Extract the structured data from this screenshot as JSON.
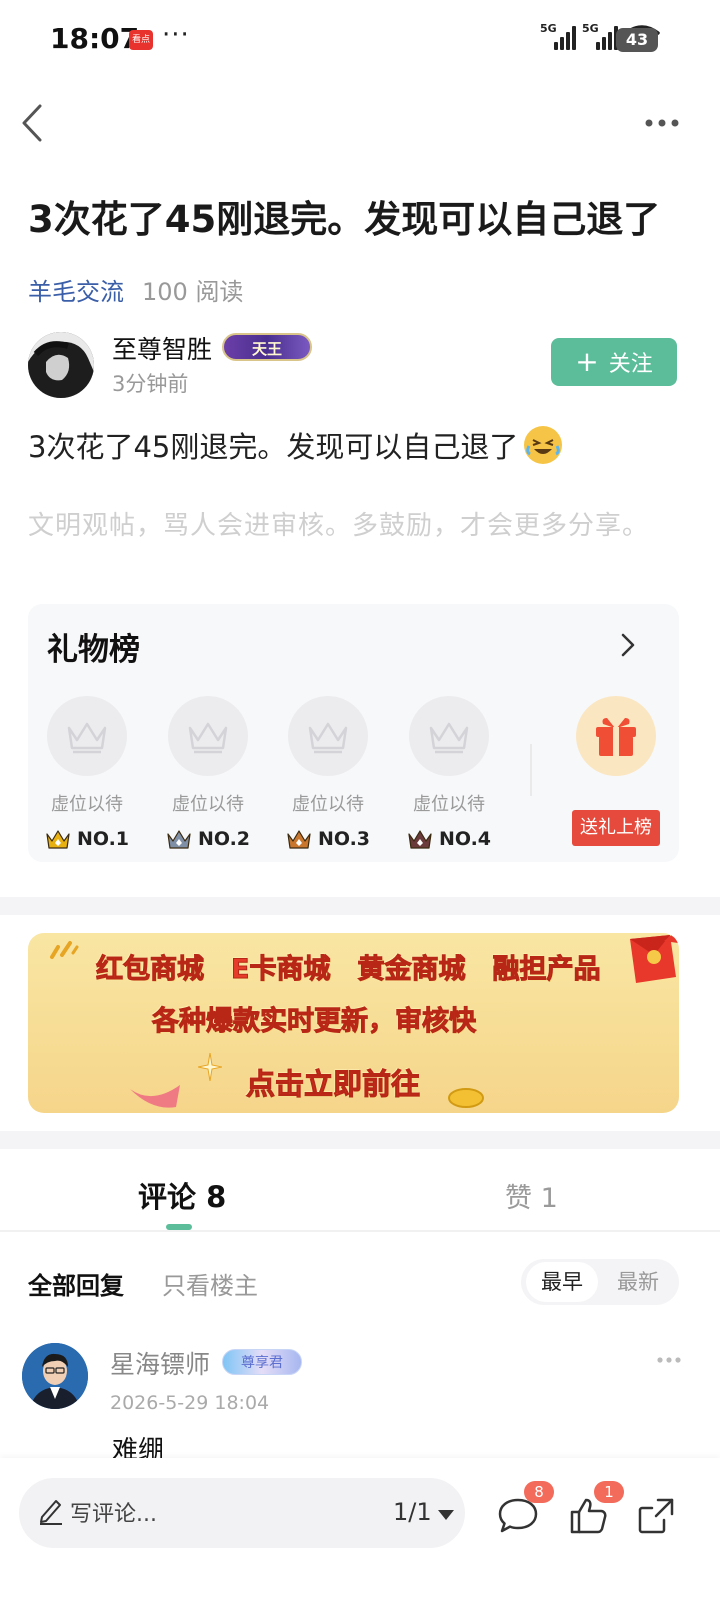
{
  "status_bar": {
    "time": "18:07",
    "app_badge": "看点",
    "more": "···",
    "network_1": "5G",
    "network_2": "5G",
    "battery": "43"
  },
  "post": {
    "title": "3次花了45刚退完。发现可以自己退了",
    "tag": "羊毛交流",
    "reads": "100 阅读",
    "author_name": "至尊智胜",
    "author_badge": "天王",
    "post_time": "3分钟前",
    "follow_label": "关注",
    "content": "3次花了45刚退完。发现可以自己退了",
    "hint": "文明观帖，骂人会进审核。多鼓励，才会更多分享。"
  },
  "gift_board": {
    "title": "礼物榜",
    "slots": [
      {
        "label": "虚位以待",
        "rank": "NO.1",
        "color": "#e8b10f"
      },
      {
        "label": "虚位以待",
        "rank": "NO.2",
        "color": "#7f8fa6"
      },
      {
        "label": "虚位以待",
        "rank": "NO.3",
        "color": "#c9772e"
      },
      {
        "label": "虚位以待",
        "rank": "NO.4",
        "color": "#6b3a3a"
      }
    ],
    "send_label": "送礼上榜"
  },
  "banner": {
    "line1": "红包商城　E卡商城　黄金商城　融担产品",
    "line2": "各种爆款实时更新，审核快",
    "line3": "点击立即前往"
  },
  "tabs": {
    "comments": "评论 8",
    "likes": "赞 1"
  },
  "filters": {
    "all": "全部回复",
    "op_only": "只看楼主",
    "sort_earliest": "最早",
    "sort_latest": "最新"
  },
  "comments": [
    {
      "name": "星海镖师",
      "badge": "尊享君",
      "time": "2026-5-29 18:04",
      "text": "难绷"
    }
  ],
  "bottom_bar": {
    "placeholder": "写评论...",
    "pager": "1/1",
    "comment_count": "8",
    "like_count": "1"
  },
  "colors": {
    "accent": "#5bbd9a",
    "tag_blue": "#3a5ea8",
    "badge_red": "#f26b5b",
    "gift_red": "#e54a3c"
  }
}
